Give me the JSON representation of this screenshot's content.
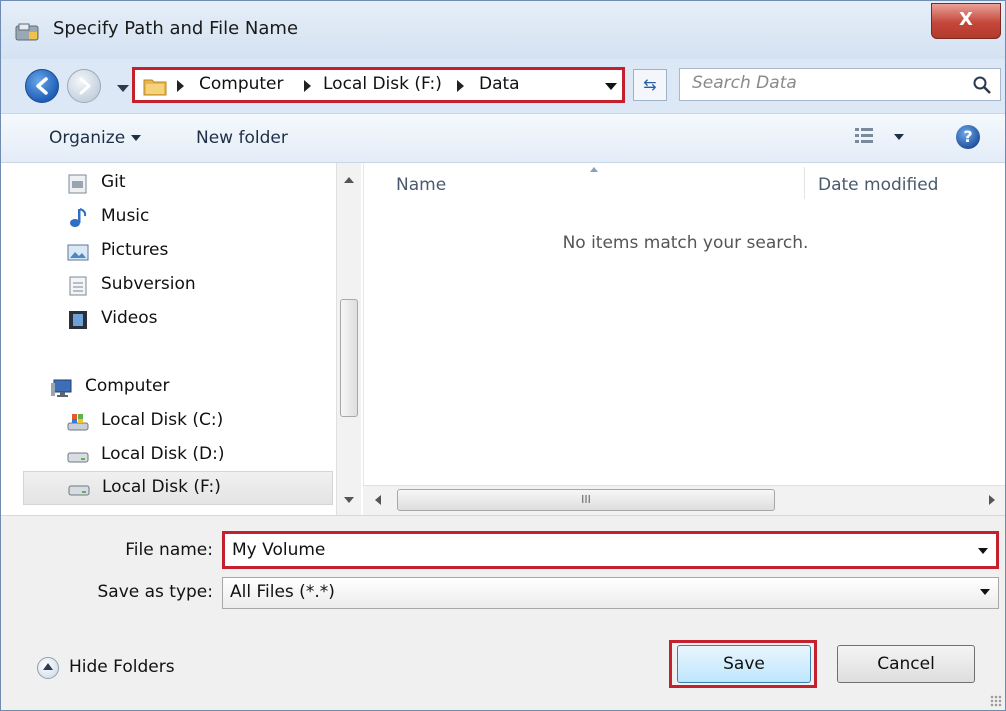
{
  "window": {
    "title": "Specify Path and File Name",
    "close_label": "X"
  },
  "nav": {
    "breadcrumbs": [
      "Computer",
      "Local Disk (F:)",
      "Data"
    ],
    "search_placeholder": "Search Data"
  },
  "toolbar": {
    "organize_label": "Organize",
    "new_folder_label": "New folder",
    "help_label": "?"
  },
  "sidebar": {
    "items": [
      {
        "label": "Git",
        "icon": "git-folder-icon"
      },
      {
        "label": "Music",
        "icon": "music-icon"
      },
      {
        "label": "Pictures",
        "icon": "pictures-icon"
      },
      {
        "label": "Subversion",
        "icon": "subversion-icon"
      },
      {
        "label": "Videos",
        "icon": "videos-icon"
      },
      {
        "label": "Computer",
        "icon": "computer-icon"
      },
      {
        "label": "Local Disk (C:)",
        "icon": "drive-c-icon"
      },
      {
        "label": "Local Disk (D:)",
        "icon": "drive-icon"
      },
      {
        "label": "Local Disk (F:)",
        "icon": "drive-icon",
        "selected": true
      }
    ]
  },
  "content": {
    "columns": [
      "Name",
      "Date modified"
    ],
    "empty_message": "No items match your search.",
    "hscroll_grip": "III"
  },
  "form": {
    "file_name_label": "File name:",
    "file_name_value": "My Volume",
    "save_type_label": "Save as type:",
    "save_type_value": "All Files (*.*)"
  },
  "footer": {
    "hide_folders_label": "Hide Folders",
    "save_label": "Save",
    "cancel_label": "Cancel"
  },
  "colors": {
    "highlight": "#c4212e",
    "accent": "#1f5fb8"
  }
}
